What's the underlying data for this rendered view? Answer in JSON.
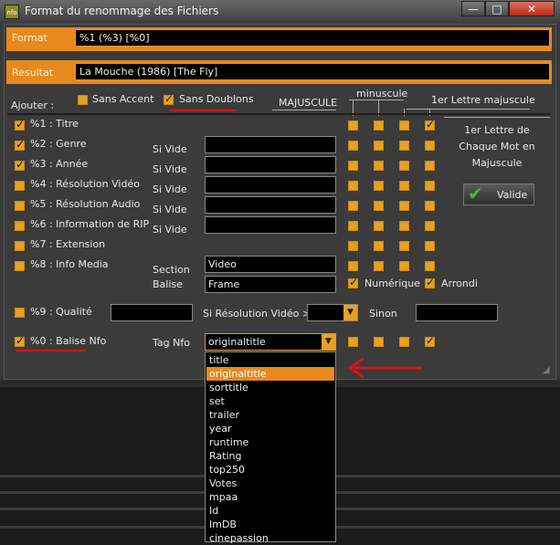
{
  "window": {
    "title": "Format du renommage des Fichiers",
    "icon": "nfo-app-icon",
    "min": "—",
    "max": "□",
    "close": "✕"
  },
  "format": {
    "label": "Format",
    "value": "%1  (%3)  [%0]"
  },
  "resultat": {
    "label": "Resultat",
    "value": "La Mouche (1986) [The Fly]"
  },
  "ajouter": {
    "label": "Ajouter :",
    "sans_accent": "Sans Accent",
    "sans_doublons": "Sans Doublons"
  },
  "case_headers": {
    "majuscule": "MAJUSCULE",
    "minuscule": "minuscule",
    "premiere": "1er Lettre majuscule",
    "chaque": "1er Lettre de Chaque Mot en Majuscule"
  },
  "rows": [
    {
      "label": "%1 : Titre",
      "checked": true,
      "sub": "",
      "cases": [
        false,
        false,
        false,
        true
      ]
    },
    {
      "label": "%2 : Genre",
      "checked": true,
      "sub": "Si Vide",
      "cases": [
        false,
        false,
        false,
        false
      ]
    },
    {
      "label": "%3 : Année",
      "checked": true,
      "sub": "Si Vide",
      "cases": [
        false,
        false,
        false,
        false
      ]
    },
    {
      "label": "%4 : Résolution Vidéo",
      "checked": false,
      "sub": "Si Vide",
      "cases": [
        false,
        false,
        false,
        false
      ]
    },
    {
      "label": "%5 : Résolution Audio",
      "checked": false,
      "sub": "Si Vide",
      "cases": [
        false,
        false,
        false,
        false
      ]
    },
    {
      "label": "%6 : Information de RIP",
      "checked": false,
      "sub": "Si Vide",
      "cases": [
        false,
        false,
        false,
        false
      ]
    },
    {
      "label": "%7 : Extension",
      "checked": false,
      "sub": "",
      "cases": [
        false,
        false,
        false,
        false
      ]
    },
    {
      "label": "%8 : Info Media",
      "checked": false,
      "sub": "Section",
      "cases": [
        false,
        false,
        false,
        false
      ]
    }
  ],
  "info_media": {
    "section_value": "Video",
    "balise_label": "Balise",
    "balise_value": "Frame",
    "numerique": "Numérique",
    "arrondi": "Arrondi"
  },
  "qualite": {
    "label": "%9 : Qualité",
    "si_resolution": "Si Résolution Vidéo >=",
    "sinon": "Sinon"
  },
  "balise_nfo": {
    "label": "%0 : Balise Nfo",
    "checked": true,
    "tag_label": "Tag Nfo",
    "tag_value": "originaltitle",
    "cases": [
      false,
      false,
      false,
      true
    ]
  },
  "valide_button": {
    "label": "Valide"
  },
  "dropdown_options": [
    "title",
    "originaltitle",
    "sorttitle",
    "set",
    "trailer",
    "year",
    "runtime",
    "Rating",
    "top250",
    "Votes",
    "mpaa",
    "Id",
    "ImDB",
    "cinepassion"
  ],
  "dropdown_selected": "originaltitle",
  "colors": {
    "accent": "#e8891d",
    "annotation": "#d6151a"
  }
}
